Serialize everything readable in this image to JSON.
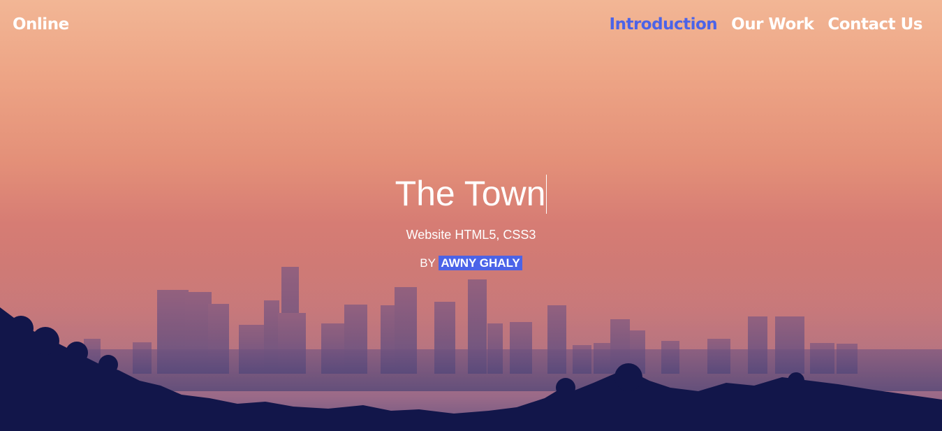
{
  "header": {
    "brand": "Online",
    "nav": [
      {
        "label": "Introduction",
        "active": true
      },
      {
        "label": "Our Work",
        "active": false
      },
      {
        "label": "Contact Us",
        "active": false
      }
    ]
  },
  "hero": {
    "title": "The Town",
    "subtitle": "Website HTML5, CSS3",
    "by_label": "BY",
    "author": "AWNY GHALY"
  },
  "colors": {
    "accent": "#4b63e8",
    "text": "#ffffff",
    "sky_top": "#f2b695",
    "sky_bottom": "#6a5483",
    "silhouette": "#12164a"
  }
}
